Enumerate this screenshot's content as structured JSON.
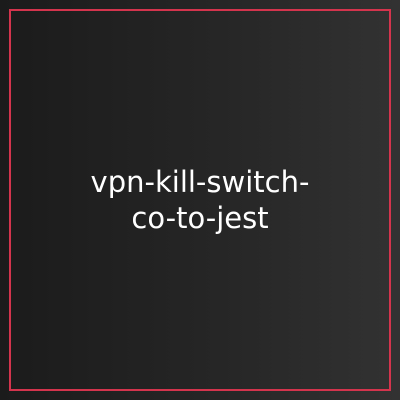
{
  "card": {
    "title_line_1": "vpn-kill-switch-",
    "title_line_2": "co-to-jest"
  },
  "colors": {
    "border": "#d4344d",
    "background_left": "#1b1b1b",
    "background_right": "#323232",
    "text": "#ffffff"
  }
}
